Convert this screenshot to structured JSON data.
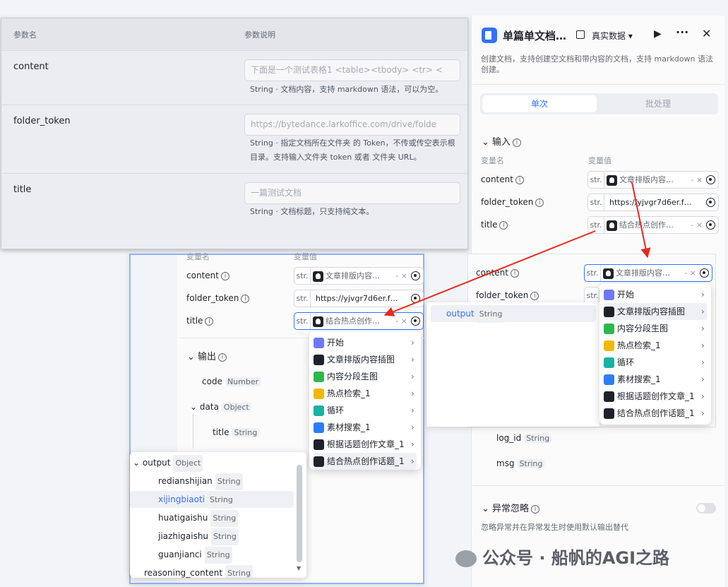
{
  "params_table": {
    "col_name": "参数名",
    "col_desc": "参数说明",
    "rows": [
      {
        "name": "content",
        "placeholder": "下面是一个测试表格1   <table><tbody> <tr> <",
        "desc": "String · 文档内容，支持 markdown 语法，可以为空。"
      },
      {
        "name": "folder_token",
        "placeholder": "https://bytedance.larkoffice.com/drive/folde",
        "desc": "String · 指定文档所在文件夹 的 Token，不传或传空表示根目录。支持输入文件夹 token 或者 文件夹 URL。"
      },
      {
        "name": "title",
        "placeholder": "一篇测试文档",
        "desc": "String · 文档标题，只支持纯文本。"
      }
    ]
  },
  "right_panel": {
    "title": "单篇单文档…",
    "data_mode": "真实数据",
    "description": "创建文档，支持创建空文档和带内容的文档，支持 markdown 语法创建。",
    "tab_single": "单次",
    "tab_batch": "批处理",
    "input_section": "输入",
    "col_var_name": "变量名",
    "col_var_value": "变量值",
    "inputs": [
      {
        "name": "content",
        "type": "str.",
        "value": "文章排版内容…"
      },
      {
        "name": "folder_token",
        "type": "str.",
        "value": "https://yjvgr7d6er.f…"
      },
      {
        "name": "title",
        "type": "str.",
        "value": "结合热点创作…"
      }
    ],
    "outputs_lower": [
      {
        "name": "log_id",
        "type": "String"
      },
      {
        "name": "msg",
        "type": "String"
      }
    ],
    "exception_title": "异常忽略",
    "exception_desc": "忽略异常并在异常发生时使用默认输出替代"
  },
  "overlay_right": {
    "col_var_name": "变量名",
    "col_var_value": "变量值",
    "inputs": [
      {
        "name": "content",
        "type": "str.",
        "value": "文章排版内容…"
      },
      {
        "name": "folder_token",
        "type": "str.",
        "value": ""
      }
    ],
    "output_item": {
      "name": "output",
      "type": "String"
    }
  },
  "mid_panel": {
    "col_var_name": "变量名",
    "col_var_value": "变量值",
    "inputs": [
      {
        "name": "content",
        "type": "str.",
        "value": "文章排版内容…"
      },
      {
        "name": "folder_token",
        "type": "str.",
        "value": "https://yjvgr7d6er.f…"
      },
      {
        "name": "title",
        "type": "str.",
        "value": "结合热点创作…"
      }
    ],
    "output_section": "输出",
    "outputs": [
      {
        "name": "code",
        "type": "Number"
      },
      {
        "name": "data",
        "type": "Object"
      },
      {
        "name": "title",
        "type": "String"
      }
    ]
  },
  "node_menu": {
    "items": [
      {
        "label": "开始",
        "icon": "start-icon",
        "color": "#6e78ff"
      },
      {
        "label": "文章排版内容插图",
        "icon": "bot-icon",
        "color": "#1f2329"
      },
      {
        "label": "内容分段生图",
        "icon": "split-icon",
        "color": "#2db84d"
      },
      {
        "label": "热点检索_1",
        "icon": "search-s-icon",
        "color": "#f5b800"
      },
      {
        "label": "循环",
        "icon": "loop-icon",
        "color": "#17b3a3"
      },
      {
        "label": "素材搜索_1",
        "icon": "bing-icon",
        "color": "#2f7cf6"
      },
      {
        "label": "根据话题创作文章_1",
        "icon": "bot-icon",
        "color": "#1f2329"
      },
      {
        "label": "结合热点创作话题_1",
        "icon": "bot-icon",
        "color": "#1f2329"
      }
    ]
  },
  "output_tree": {
    "root": {
      "name": "output",
      "type": "Object"
    },
    "children": [
      {
        "name": "redianshijian",
        "type": "String"
      },
      {
        "name": "xijingbiaoti",
        "type": "String"
      },
      {
        "name": "huatigaishu",
        "type": "String"
      },
      {
        "name": "jiazhigaishu",
        "type": "String"
      },
      {
        "name": "guanjianci",
        "type": "String"
      }
    ],
    "tail": {
      "name": "reasoning_content",
      "type": "String"
    }
  },
  "watermark": "公众号 · 船帆的AGI之路",
  "colors": {
    "accent": "#3370ff",
    "arrow": "#e8291c"
  }
}
